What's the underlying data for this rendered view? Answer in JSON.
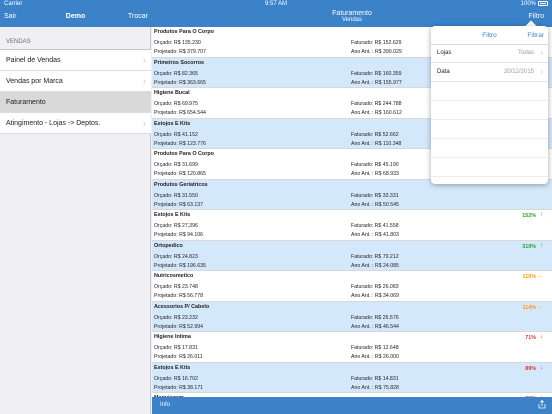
{
  "status_bar": {
    "carrier": "Carrier",
    "time": "9:57 AM",
    "battery": "100%"
  },
  "nav": {
    "left_button": "Sair",
    "left_title": "Demo",
    "switch_button": "Trocar",
    "main_title": "Faturamento",
    "main_subtitle": "Vendas",
    "filter_button": "Filtro"
  },
  "sidebar": {
    "section": "VENDAS",
    "items": [
      {
        "label": "Painel de Vendas",
        "selected": false
      },
      {
        "label": "Vendas por Marca",
        "selected": false
      },
      {
        "label": "Faturamento",
        "selected": true
      },
      {
        "label": "Atingimento - Lojas -> Deptos.",
        "selected": false
      }
    ]
  },
  "filter_popover": {
    "title": "Filtro",
    "action": "Filtrar",
    "rows": [
      {
        "label": "Lojas",
        "value": "Todas"
      },
      {
        "label": "Data",
        "value": "20/12/2015"
      }
    ]
  },
  "rows": [
    {
      "name": "Produtos Para O Corpo",
      "orcado": "Orçado: R$ 135.230",
      "projetado": "Projetado: R$ 379.707",
      "faturado": "Faturado: R$ 152.629",
      "ano_ant": "Ano Ant. : R$ 390.029",
      "pct": "",
      "arrow": "",
      "color": "",
      "bg": "white"
    },
    {
      "name": "Primeiros Socorros",
      "orcado": "Orçado: R$ 82.365",
      "projetado": "Projetado: R$ 363.665",
      "faturado": "Faturado: R$ 160.359",
      "ano_ant": "Ano Ant. : R$ 155.977",
      "pct": "",
      "arrow": "",
      "color": "",
      "bg": "blue"
    },
    {
      "name": "Higiene Bucal",
      "orcado": "Orçado: R$ 69.975",
      "projetado": "Projetado: R$ 654.544",
      "faturado": "Faturado: R$ 244.788",
      "ano_ant": "Ano Ant. : R$ 160.612",
      "pct": "",
      "arrow": "",
      "color": "",
      "bg": "white"
    },
    {
      "name": "Estojos E Kits",
      "orcado": "Orçado: R$ 41.152",
      "projetado": "Projetado: R$ 123.776",
      "faturado": "Faturado: R$ 52.662",
      "ano_ant": "Ano Ant. : R$ 110.348",
      "pct": "",
      "arrow": "",
      "color": "",
      "bg": "blue"
    },
    {
      "name": "Produtos Para O Corpo",
      "orcado": "Orçado: R$ 31.699",
      "projetado": "Projetado: R$ 120.865",
      "faturado": "Faturado: R$ 45.190",
      "ano_ant": "Ano Ant. : R$ 68.933",
      "pct": "",
      "arrow": "",
      "color": "",
      "bg": "white"
    },
    {
      "name": "Produtos Geriatricos",
      "orcado": "Orçado: R$ 31.550",
      "projetado": "Projetado: R$ 63.137",
      "faturado": "Faturado: R$ 33.331",
      "ano_ant": "Ano Ant. : R$ 50.545",
      "pct": "",
      "arrow": "",
      "color": "",
      "bg": "blue"
    },
    {
      "name": "Estojos E Kits",
      "orcado": "Orçado: R$ 27.396",
      "projetado": "Projetado: R$ 94.106",
      "faturado": "Faturado: R$ 41.558",
      "ano_ant": "Ano Ant. : R$ 41.803",
      "pct": "152%",
      "arrow": "↑",
      "color": "#2ca02c",
      "bg": "white"
    },
    {
      "name": "Ortopedico",
      "orcado": "Orçado: R$ 24.823",
      "projetado": "Projetado: R$ 196.635",
      "faturado": "Faturado: R$ 79.212",
      "ano_ant": "Ano Ant. : R$ 24.085",
      "pct": "319%",
      "arrow": "↑",
      "color": "#2ca02c",
      "bg": "blue"
    },
    {
      "name": "Nutricosmetico",
      "orcado": "Orçado: R$ 23.748",
      "projetado": "Projetado: R$ 56.778",
      "faturado": "Faturado: R$ 26.083",
      "ano_ant": "Ano Ant. : R$ 34.069",
      "pct": "110%",
      "arrow": "→",
      "color": "#ff9900",
      "bg": "white"
    },
    {
      "name": "Acessorios P/ Cabelo",
      "orcado": "Orçado: R$ 23.232",
      "projetado": "Projetado: R$ 52.994",
      "faturado": "Faturado: R$ 26.576",
      "ano_ant": "Ano Ant. : R$ 46.544",
      "pct": "114%",
      "arrow": "→",
      "color": "#ff9900",
      "bg": "blue"
    },
    {
      "name": "Higiene Intima",
      "orcado": "Orçado: R$ 17.831",
      "projetado": "Projetado: R$ 26.011",
      "faturado": "Faturado: R$ 12.648",
      "ano_ant": "Ano Ant. : R$ 26.000",
      "pct": "71%",
      "arrow": "↓",
      "color": "#e03030",
      "bg": "white"
    },
    {
      "name": "Estojos E Kits",
      "orcado": "Orçado: R$ 16.702",
      "projetado": "Projetado: R$ 38.171",
      "faturado": "Faturado: R$ 14.831",
      "ano_ant": "Ano Ant. : R$ 75.828",
      "pct": "89%",
      "arrow": "↓",
      "color": "#e03030",
      "bg": "blue"
    },
    {
      "name": "Maquiagem",
      "orcado": "",
      "projetado": "",
      "faturado": "",
      "ano_ant": "",
      "pct": "58%",
      "arrow": "↓",
      "color": "#e03030",
      "bg": "white"
    }
  ],
  "bottom_bar": {
    "info": "Info",
    "share_icon": "share-icon"
  },
  "colors": {
    "accent": "#3b82c8",
    "row_blue": "#d4e8fb",
    "up": "#2ca02c",
    "flat": "#ff9900",
    "down": "#e03030"
  }
}
